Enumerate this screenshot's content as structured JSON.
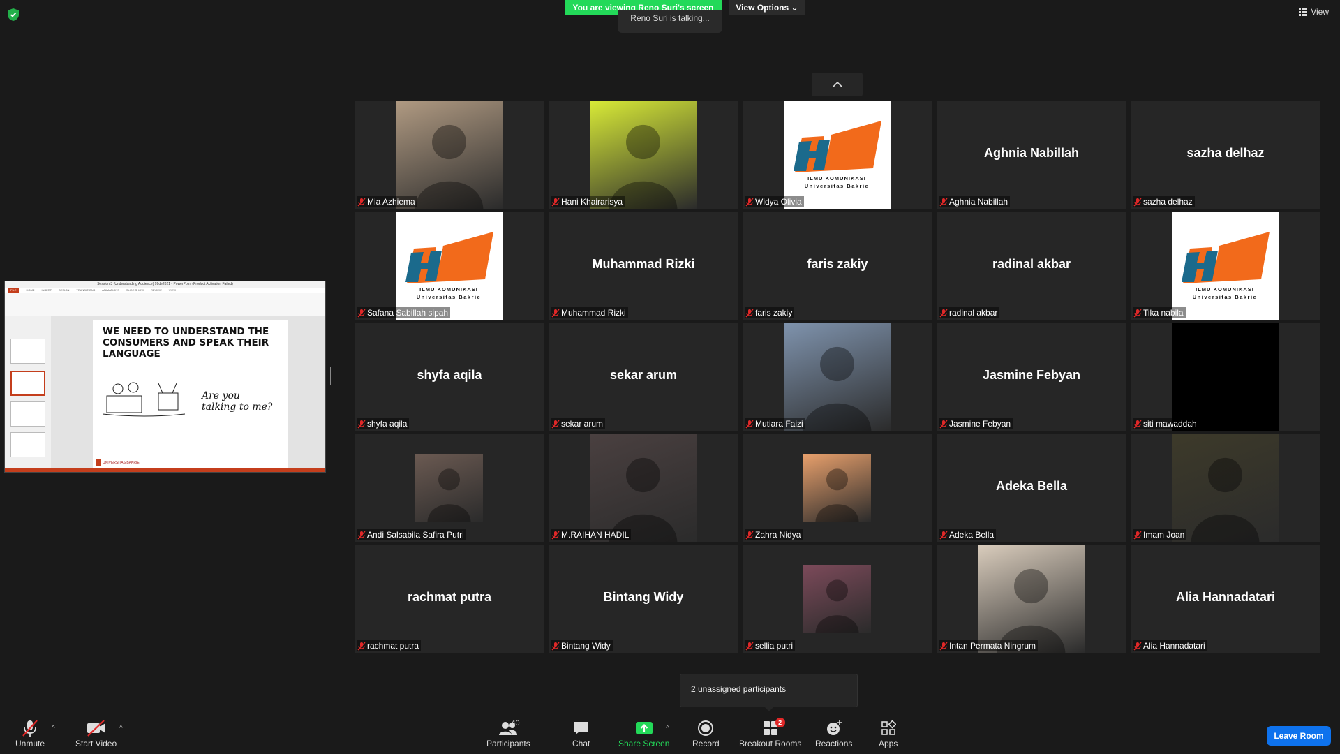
{
  "top": {
    "viewing_banner": "You are viewing Reno Suri's screen",
    "talking_indicator": "Reno Suri is talking...",
    "view_options_label": "View Options",
    "view_label": "View"
  },
  "shared_screen": {
    "window_title": "Session 3 (Understanding Audience) 99de2021 - PowerPoint (Product Activation Failed)",
    "ribbon_tabs": [
      "FILE",
      "HOME",
      "INSERT",
      "DESIGN",
      "TRANSITIONS",
      "ANIMATIONS",
      "SLIDE SHOW",
      "REVIEW",
      "VIEW"
    ],
    "slide_heading_part1": "WE NEED TO UNDERSTAND THE CONSUMERS AND ",
    "slide_heading_bold": "SPEAK THEIR LANGUAGE",
    "slide_subtitle_1": "Are you",
    "slide_subtitle_2": "talking to me?",
    "slide_logo_text": "UNIVERSITAS BAKRIE"
  },
  "tiles": [
    {
      "name": "Mia Azhiema",
      "kind": "photo",
      "color": "#b09a82"
    },
    {
      "name": "Hani Khairarisya",
      "kind": "photo",
      "color": "#d8ea37"
    },
    {
      "name": "Widya Olivia",
      "kind": "logo"
    },
    {
      "name": "Aghnia Nabillah",
      "kind": "name"
    },
    {
      "name": "sazha delhaz",
      "kind": "name"
    },
    {
      "name": "Safana Sabillah sipah",
      "kind": "logo"
    },
    {
      "name": "Muhammad Rizki",
      "kind": "name"
    },
    {
      "name": "faris zakiy",
      "kind": "name"
    },
    {
      "name": "radinal akbar",
      "kind": "name"
    },
    {
      "name": "Tika nabila",
      "kind": "logo"
    },
    {
      "name": "shyfa aqila",
      "kind": "name"
    },
    {
      "name": "sekar arum",
      "kind": "name"
    },
    {
      "name": "Mutiara Faizi",
      "kind": "photo",
      "color": "#7f93ad"
    },
    {
      "name": "Jasmine Febyan",
      "kind": "name"
    },
    {
      "name": "siti mawaddah",
      "kind": "black"
    },
    {
      "name": "Andi Salsabila Safira Putri",
      "kind": "photo-small",
      "color": "#6b5a52"
    },
    {
      "name": "M.RAIHAN HADIL",
      "kind": "photo",
      "color": "#4a4040"
    },
    {
      "name": "Zahra Nidya",
      "kind": "photo-small",
      "color": "#e8a06c"
    },
    {
      "name": "Adeka Bella",
      "kind": "name"
    },
    {
      "name": "Imam Joan",
      "kind": "photo",
      "color": "#3d3a2a"
    },
    {
      "name": "rachmat putra",
      "kind": "name"
    },
    {
      "name": "Bintang Widy",
      "kind": "name"
    },
    {
      "name": "sellia putri",
      "kind": "photo-small",
      "color": "#7c4a5a"
    },
    {
      "name": "Intan Permata Ningrum",
      "kind": "photo",
      "color": "#d9ccbc"
    },
    {
      "name": "Alia Hannadatari",
      "kind": "name"
    }
  ],
  "logo": {
    "line1": "ILMU KOMUNIKASI",
    "line2": "Universitas Bakrie"
  },
  "unassigned_text": "2 unassigned participants",
  "toolbar": {
    "unmute": "Unmute",
    "start_video": "Start Video",
    "participants": "Participants",
    "participants_count": "40",
    "chat": "Chat",
    "share_screen": "Share Screen",
    "record": "Record",
    "breakout_rooms": "Breakout Rooms",
    "breakout_badge": "2",
    "reactions": "Reactions",
    "apps": "Apps",
    "leave_room": "Leave Room"
  },
  "colors": {
    "share_green": "#23d959",
    "leave_blue": "#0e72ed",
    "mic_red": "#e02828",
    "logo_blue": "#1b6a8c",
    "logo_orange": "#f26a1b"
  }
}
